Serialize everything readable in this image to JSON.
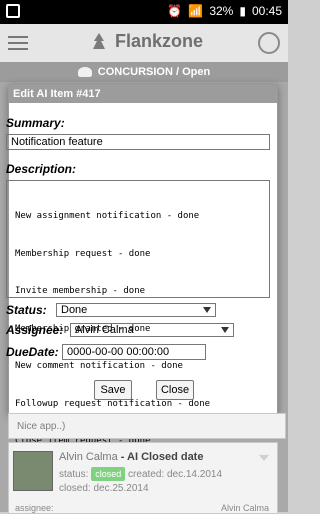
{
  "status": {
    "battery": "32%",
    "time": "00:45"
  },
  "app": {
    "name": "Flankzone"
  },
  "subheader": {
    "text": "CONCURSION / Open"
  },
  "dialog": {
    "title": "Edit AI Item #417",
    "summary_label": "Summary:",
    "summary_value": "Notification feature",
    "description_label": "Description:",
    "description_lines": [
      "New assignment notification - done",
      "Membership request - done",
      "Invite membership - done",
      "Membership granted - done",
      "New comment notification - done",
      "Followup request notification - done",
      "Close item request - done"
    ],
    "status_label": "Status:",
    "status_value": "Done",
    "assignee_label": "Assignee:",
    "assignee_value": "Alvin Calma",
    "duedate_label": "DueDate:",
    "duedate_value": "0000-00-00 00:00:00",
    "save_label": "Save",
    "close_label": "Close"
  },
  "background_list": {
    "snippet": "Nice app..)",
    "card": {
      "name": "Alvin Calma",
      "action": "- AI Closed date",
      "status_label": "status:",
      "status_value": "closed",
      "created_label": "created:",
      "created_value": "dec.14.2014",
      "closed_label": "closed:",
      "closed_value": "dec.25.2014",
      "assignee_label": "assignee:",
      "assignee_value": "Alvin Calma"
    }
  }
}
